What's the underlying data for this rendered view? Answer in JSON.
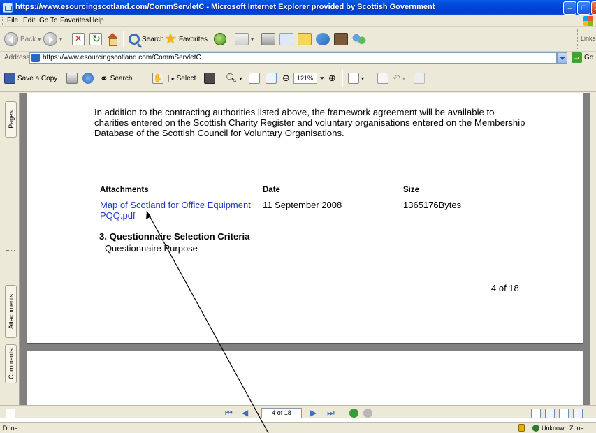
{
  "window": {
    "title": "https://www.esourcingscotland.com/CommServletC - Microsoft Internet Explorer provided by Scottish Government"
  },
  "menu": [
    "File",
    "Edit",
    "Go To",
    "Favorites",
    "Help"
  ],
  "toolbar": {
    "back_label": "Back",
    "search_label": "Search",
    "favorites_label": "Favorites",
    "links_label": "Links"
  },
  "address": {
    "label": "Address",
    "url": "https://www.esourcingscotland.com/CommServletC",
    "go_label": "Go"
  },
  "reader": {
    "save_copy_label": "Save a Copy",
    "search_label": "Search",
    "select_label": "Select",
    "zoom_value": "121%"
  },
  "side_tabs": {
    "pages": "Pages",
    "attachments": "Attachments",
    "comments": "Comments"
  },
  "document": {
    "intro_paragraph": "In addition to the contracting authorities listed above, the framework agreement will be available to charities entered on the Scottish Charity Register and voluntary organisations entered on the Membership Database of the Scottish Council for Voluntary Organisations.",
    "table": {
      "headers": [
        "Attachments",
        "Date",
        "Size"
      ],
      "rows": [
        {
          "attachment": "Map of Scotland for Office Equipment PQQ.pdf",
          "date": "11 September 2008",
          "size": "1365176Bytes"
        }
      ]
    },
    "section_title": "3. Questionnaire Selection Criteria",
    "section_subtitle": "- Questionnaire Purpose",
    "page_indicator": "4 of 18"
  },
  "navigation": {
    "page_field": "4 of 18"
  },
  "status": {
    "text": "Done",
    "zone": "Unknown Zone"
  },
  "colors": {
    "title_bar": "#0a5ce8",
    "link": "#1a35c8",
    "doc_background": "#808080"
  }
}
